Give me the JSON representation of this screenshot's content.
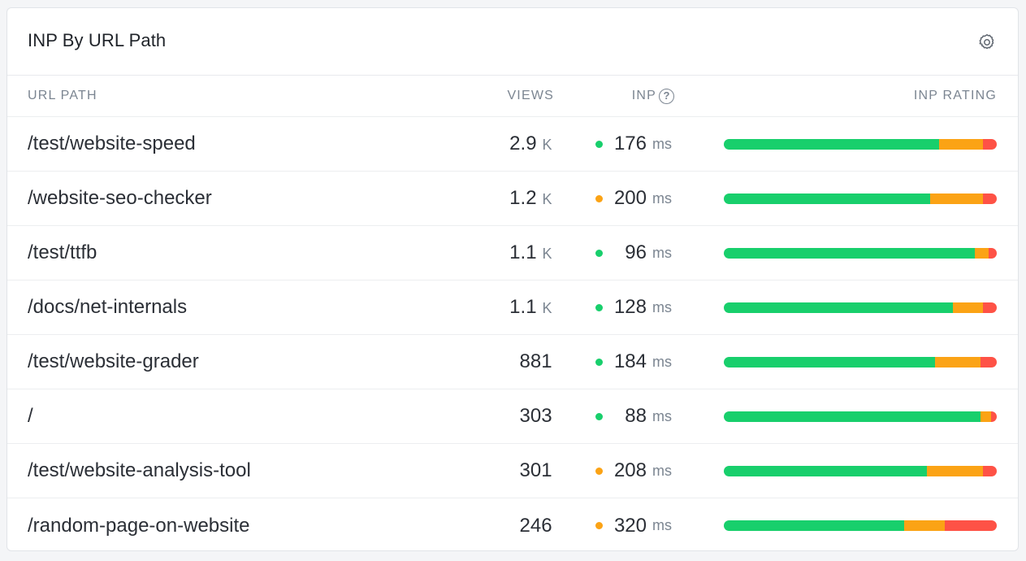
{
  "title": "INP By URL Path",
  "settings_icon": "gear-icon",
  "colors": {
    "good": "#18cf6c",
    "needs_improvement": "#fba315",
    "poor": "#fe5246"
  },
  "columns": {
    "path": "URL PATH",
    "views": "VIEWS",
    "inp": "INP",
    "help_icon": "?",
    "rating": "INP RATING"
  },
  "rows": [
    {
      "path": "/test/website-speed",
      "views": "2.9",
      "views_unit": "K",
      "inp": "176",
      "inp_unit": "ms",
      "status": "good",
      "rating": {
        "good": 0.79,
        "needs_improvement": 0.16,
        "poor": 0.05
      }
    },
    {
      "path": "/website-seo-checker",
      "views": "1.2",
      "views_unit": "K",
      "inp": "200",
      "inp_unit": "ms",
      "status": "needs_improvement",
      "rating": {
        "good": 0.755,
        "needs_improvement": 0.195,
        "poor": 0.05
      }
    },
    {
      "path": "/test/ttfb",
      "views": "1.1",
      "views_unit": "K",
      "inp": "96",
      "inp_unit": "ms",
      "status": "good",
      "rating": {
        "good": 0.92,
        "needs_improvement": 0.05,
        "poor": 0.03
      }
    },
    {
      "path": "/docs/net-internals",
      "views": "1.1",
      "views_unit": "K",
      "inp": "128",
      "inp_unit": "ms",
      "status": "good",
      "rating": {
        "good": 0.84,
        "needs_improvement": 0.11,
        "poor": 0.05
      }
    },
    {
      "path": "/test/website-grader",
      "views": "881",
      "views_unit": "",
      "inp": "184",
      "inp_unit": "ms",
      "status": "good",
      "rating": {
        "good": 0.775,
        "needs_improvement": 0.165,
        "poor": 0.06
      }
    },
    {
      "path": "/",
      "views": "303",
      "views_unit": "",
      "inp": "88",
      "inp_unit": "ms",
      "status": "good",
      "rating": {
        "good": 0.94,
        "needs_improvement": 0.04,
        "poor": 0.02
      }
    },
    {
      "path": "/test/website-analysis-tool",
      "views": "301",
      "views_unit": "",
      "inp": "208",
      "inp_unit": "ms",
      "status": "needs_improvement",
      "rating": {
        "good": 0.745,
        "needs_improvement": 0.205,
        "poor": 0.05
      }
    },
    {
      "path": "/random-page-on-website",
      "views": "246",
      "views_unit": "",
      "inp": "320",
      "inp_unit": "ms",
      "status": "needs_improvement",
      "rating": {
        "good": 0.66,
        "needs_improvement": 0.15,
        "poor": 0.19
      }
    }
  ]
}
